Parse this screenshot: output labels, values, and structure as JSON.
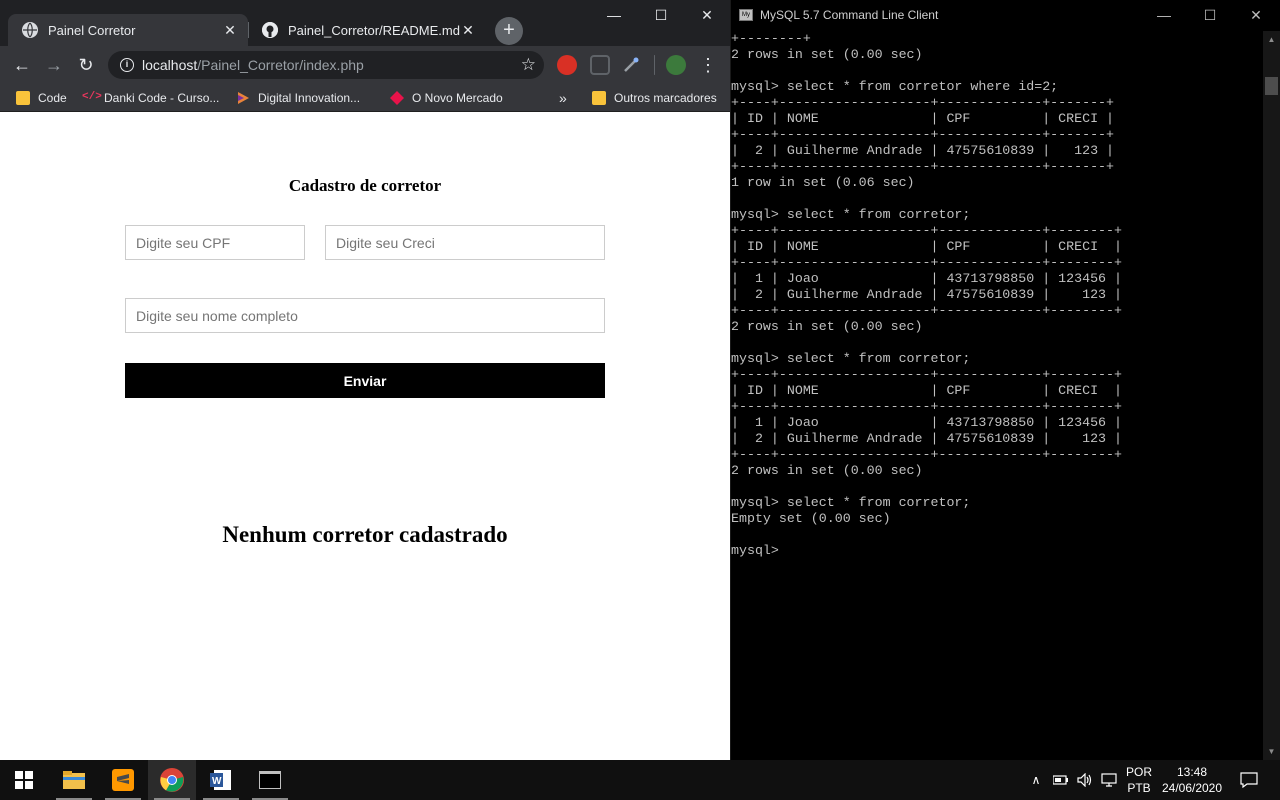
{
  "chrome": {
    "tabs": [
      {
        "title": "Painel Corretor",
        "active": true,
        "icon": "globe-icon"
      },
      {
        "title": "Painel_Corretor/README.md at m",
        "active": false,
        "icon": "github-icon"
      }
    ],
    "new_tab_symbol": "+",
    "window_controls": {
      "minimize": "—",
      "maximize": "☐",
      "close": "✕"
    },
    "url": {
      "host": "localhost",
      "path": "/Painel_Corretor/index.php"
    },
    "bookmarks": [
      {
        "label": "Code",
        "icon": "folder-icon"
      },
      {
        "label": "Danki Code - Curso...",
        "icon": "code-icon"
      },
      {
        "label": "Digital Innovation...",
        "icon": "dio-icon"
      },
      {
        "label": "O Novo Mercado",
        "icon": "diamond-icon"
      }
    ],
    "bookmarks_overflow": "»",
    "other_bookmarks": "Outros marcadores"
  },
  "page": {
    "form_title": "Cadastro de corretor",
    "cpf_placeholder": "Digite seu CPF",
    "creci_placeholder": "Digite seu Creci",
    "name_placeholder": "Digite seu nome completo",
    "submit_label": "Enviar",
    "empty_message": "Nenhum corretor cadastrado"
  },
  "console": {
    "title": "MySQL 5.7 Command Line Client",
    "lines": [
      "+--------+",
      "2 rows in set (0.00 sec)",
      "",
      "mysql> select * from corretor where id=2;",
      "+----+-------------------+-------------+-------+",
      "| ID | NOME              | CPF         | CRECI |",
      "+----+-------------------+-------------+-------+",
      "|  2 | Guilherme Andrade | 47575610839 |   123 |",
      "+----+-------------------+-------------+-------+",
      "1 row in set (0.06 sec)",
      "",
      "mysql> select * from corretor;",
      "+----+-------------------+-------------+--------+",
      "| ID | NOME              | CPF         | CRECI  |",
      "+----+-------------------+-------------+--------+",
      "|  1 | Joao              | 43713798850 | 123456 |",
      "|  2 | Guilherme Andrade | 47575610839 |    123 |",
      "+----+-------------------+-------------+--------+",
      "2 rows in set (0.00 sec)",
      "",
      "mysql> select * from corretor;",
      "+----+-------------------+-------------+--------+",
      "| ID | NOME              | CPF         | CRECI  |",
      "+----+-------------------+-------------+--------+",
      "|  1 | Joao              | 43713798850 | 123456 |",
      "|  2 | Guilherme Andrade | 47575610839 |    123 |",
      "+----+-------------------+-------------+--------+",
      "2 rows in set (0.00 sec)",
      "",
      "mysql> select * from corretor;",
      "Empty set (0.00 sec)",
      "",
      "mysql>"
    ]
  },
  "taskbar": {
    "apps": [
      {
        "name": "windows-start",
        "icon": "windows-icon"
      },
      {
        "name": "file-explorer",
        "icon": "folder-icon"
      },
      {
        "name": "sublime-text",
        "icon": "sublime-icon"
      },
      {
        "name": "google-chrome",
        "icon": "chrome-icon"
      },
      {
        "name": "microsoft-word",
        "icon": "word-icon"
      },
      {
        "name": "mysql-console",
        "icon": "console-icon"
      }
    ],
    "lang_top": "POR",
    "lang_bottom": "PTB",
    "time": "13:48",
    "date": "24/06/2020"
  },
  "colors": {
    "chrome_dark": "#202124",
    "chrome_toolbar": "#35363a",
    "console_bg": "#000000",
    "console_text": "#c0c0c0",
    "button_bg": "#000000",
    "taskbar_bg": "#101010"
  }
}
